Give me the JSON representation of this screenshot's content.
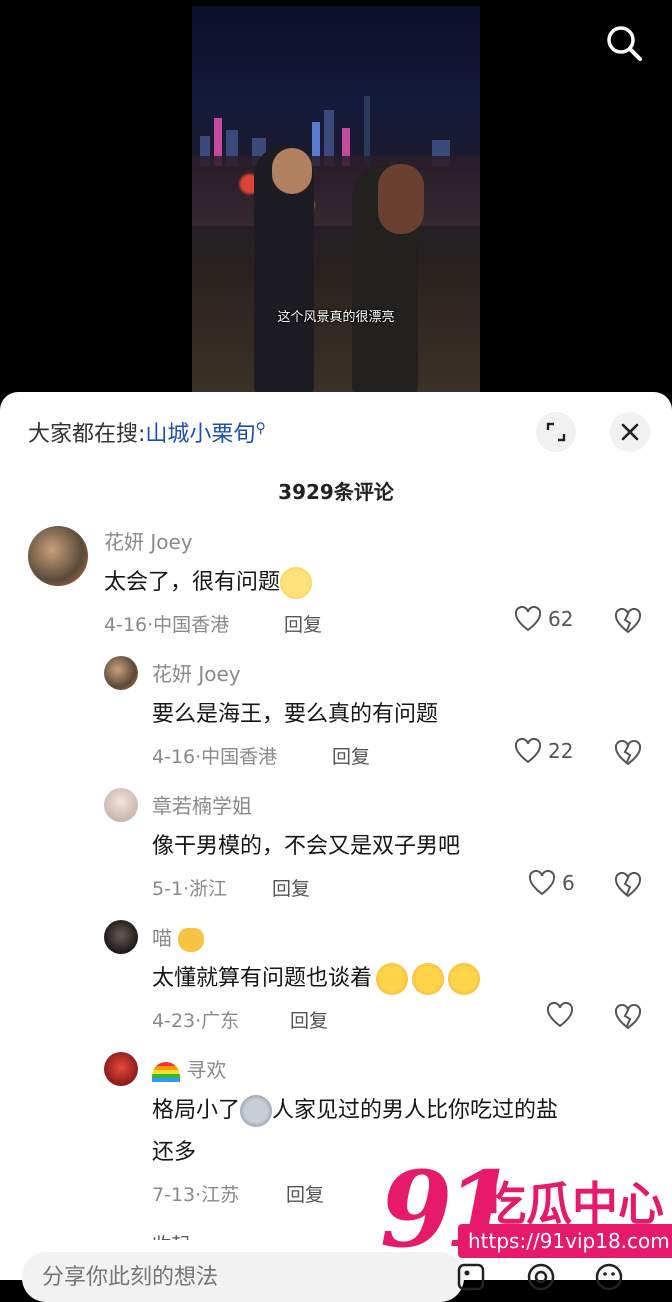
{
  "video": {
    "subtitle": "这个风景真的很漂亮"
  },
  "header": {
    "search_prefix": "大家都在搜:",
    "search_query": "山城小栗旬",
    "comment_count": "3929条评论"
  },
  "comments": [
    {
      "user": "花妍 Joey",
      "text": "太会了，很有问题",
      "date": "4-16·中国香港",
      "reply": "回复",
      "likes": "62"
    },
    {
      "user": "花妍 Joey",
      "text": "要么是海王，要么真的有问题",
      "date": "4-16·中国香港",
      "reply": "回复",
      "likes": "22"
    },
    {
      "user": "章若楠学姐",
      "text": "像干男模的，不会又是双子男吧",
      "date": "5-1·浙江",
      "reply": "回复",
      "likes": "6"
    },
    {
      "user": "喵",
      "text": "太懂就算有问题也谈着",
      "date": "4-23·广东",
      "reply": "回复",
      "likes": ""
    },
    {
      "user": "寻欢",
      "text": "格局小了",
      "text2": "人家见过的男人比你吃过的盐",
      "text3": "还多",
      "date": "7-13·江苏",
      "reply": "回复",
      "likes": ""
    }
  ],
  "footer": {
    "collapse": "收起",
    "placeholder": "分享你此刻的想法"
  },
  "watermark": {
    "brand": "91",
    "name": "吃瓜中心",
    "url": "https://91vip18.com"
  },
  "colors": {
    "accent": "#1d4fb0",
    "watermark": "#e6196b"
  },
  "icons": [
    "search-icon",
    "expand-icon",
    "close-icon",
    "heart-icon",
    "broken-heart-icon",
    "image-icon",
    "at-icon",
    "emoji-icon"
  ]
}
